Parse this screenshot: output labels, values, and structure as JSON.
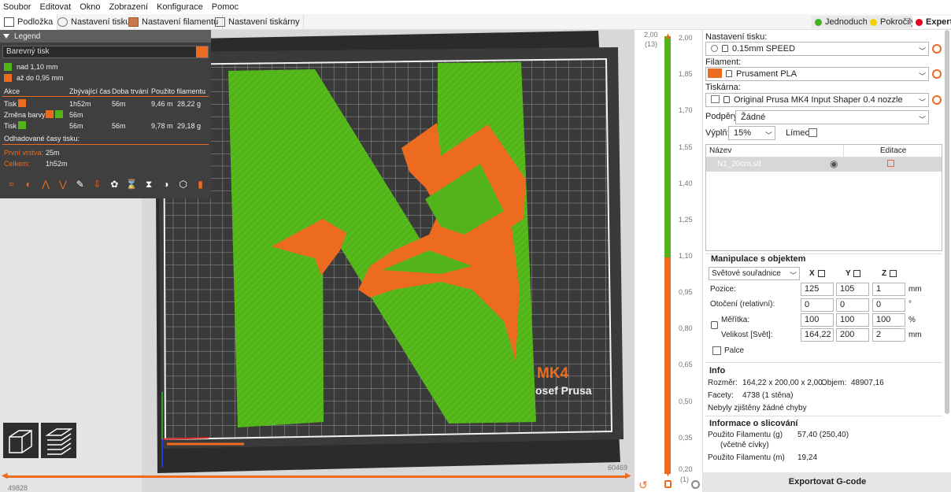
{
  "menu": [
    "Soubor",
    "Editovat",
    "Okno",
    "Zobrazení",
    "Konfigurace",
    "Pomoc"
  ],
  "tabs": [
    {
      "label": "Podložka",
      "icon": "bed-icon"
    },
    {
      "label": "Nastavení tisku",
      "icon": "gear-icon"
    },
    {
      "label": "Nastavení filamentu",
      "icon": "filament-icon"
    },
    {
      "label": "Nastavení tiskárny",
      "icon": "printer-icon"
    }
  ],
  "modes": [
    {
      "label": "Jednoduchý",
      "color": "#3cb521"
    },
    {
      "label": "Pokročilý",
      "color": "#f0d400"
    },
    {
      "label": "Expert",
      "color": "#e6001c"
    }
  ],
  "legend": {
    "title": "Legend",
    "view_type": "Barevný tisk",
    "ranges": [
      {
        "label": "nad 1,10 mm",
        "color": "#53b41a"
      },
      {
        "label": "až do 0,95 mm",
        "color": "#ed6b21"
      }
    ],
    "columns": [
      "Akce",
      "Zbývající čas",
      "Doba trvání",
      "Použito filamentu"
    ],
    "rows": [
      {
        "action": "Tisk",
        "remaining": "1h52m",
        "duration": "56m",
        "length": "9,46 m",
        "weight": "28,22 g"
      },
      {
        "action": "Změna barvy",
        "remaining": "56m",
        "duration": "",
        "length": "",
        "weight": ""
      },
      {
        "action": "Tisk",
        "remaining": "56m",
        "duration": "56m",
        "length": "9,78 m",
        "weight": "29,18 g"
      }
    ],
    "estimated_label": "Odhadované časy tisku:",
    "first_layer_label": "První vrstva:",
    "first_layer_value": "25m",
    "total_label": "Celkem:",
    "total_value": "1h52m"
  },
  "bed_label": {
    "model": "MK4",
    "brand": "osef Prusa"
  },
  "vslider": {
    "top_value": "2,00",
    "top_layer": "(13)",
    "bottom_value": "0,20",
    "bottom_layer": "(1)",
    "ticks": [
      "2,00",
      "1,85",
      "1,70",
      "1,55",
      "1,40",
      "1,25",
      "1,10",
      "0,95",
      "0,80",
      "0,65",
      "0,50",
      "0,35",
      "0,20"
    ],
    "color_change_at": "1,10"
  },
  "hslider": {
    "left_value": "49828",
    "right_value": "60469"
  },
  "panel": {
    "print_settings_label": "Nastavení tisku:",
    "print_settings_value": "0.15mm SPEED",
    "filament_label": "Filament:",
    "filament_value": "Prusament PLA",
    "filament_color": "#ed6b21",
    "printer_label": "Tiskárna:",
    "printer_value": "Original Prusa MK4 Input Shaper 0.4 nozzle",
    "supports_label": "Podpěry:",
    "supports_value": "Žádné",
    "infill_label": "Výplň:",
    "infill_value": "15%",
    "brim_label": "Límec:",
    "list_col_name": "Název",
    "list_col_edit": "Editace",
    "object_name": "N1_20cm.stl",
    "manip_title": "Manipulace s objektem",
    "coords_value": "Světové souřadnice",
    "axes": [
      "X",
      "Y",
      "Z"
    ],
    "position_label": "Pozice:",
    "position": [
      "125",
      "105",
      "1"
    ],
    "position_unit": "mm",
    "rotation_label": "Otočení (relativní):",
    "rotation": [
      "0",
      "0",
      "0"
    ],
    "rotation_unit": "°",
    "scale_label": "Měřítka:",
    "scale": [
      "100",
      "100",
      "100"
    ],
    "scale_unit": "%",
    "size_label": "Velikost [Svět]:",
    "size": [
      "164,22",
      "200",
      "2"
    ],
    "size_unit": "mm",
    "inches_label": "Palce",
    "info_title": "Info",
    "size_info_label": "Rozměr:",
    "size_info_value": "164,22 x 200,00 x 2,00",
    "volume_label": "Objem:",
    "volume_value": "48907,16",
    "facets_label": "Facety:",
    "facets_value": "4738 (1 stěna)",
    "errors_text": "Nebyly zjištěny žádné chyby",
    "slice_title": "Informace o slicování",
    "used_g_label": "Použito Filamentu (g)",
    "used_g_sub": "(včetně cívky)",
    "used_g_value": "57,40 (250,40)",
    "used_m_label": "Použito Filamentu (m)",
    "used_m_value": "19,24",
    "export_label": "Exportovat G-code"
  },
  "colors": {
    "accent": "#ed6b21",
    "green": "#53b41a",
    "bed": "#2b2b2b"
  }
}
